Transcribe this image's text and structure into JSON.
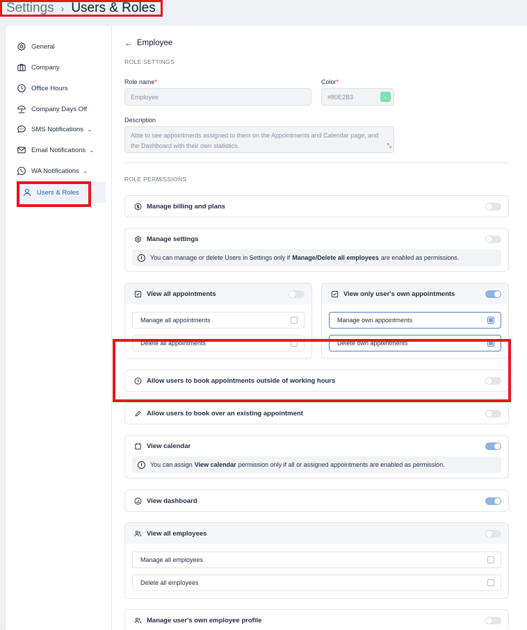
{
  "breadcrumb": {
    "root": "Settings",
    "separator": "›",
    "current": "Users & Roles"
  },
  "sidebar": {
    "items": [
      {
        "label": "General",
        "icon": "gear-icon"
      },
      {
        "label": "Company",
        "icon": "briefcase-icon"
      },
      {
        "label": "Office Hours",
        "icon": "clock-icon"
      },
      {
        "label": "Company Days Off",
        "icon": "umbrella-icon"
      },
      {
        "label": "SMS Notifications",
        "icon": "chat-bubble-icon",
        "chevron": "⌄"
      },
      {
        "label": "Email Notifications",
        "icon": "envelope-icon",
        "chevron": "⌄"
      },
      {
        "label": "WA Notifications",
        "icon": "whatsapp-icon",
        "chevron": "⌄"
      },
      {
        "label": "Users & Roles",
        "icon": "user-icon",
        "active": true
      }
    ]
  },
  "header": {
    "back_arrow": "←",
    "title": "Employee"
  },
  "role_settings": {
    "heading": "ROLE SETTINGS",
    "role_name_label": "Role name",
    "role_name_value": "Employee",
    "color_label": "Color",
    "color_value": "#80E2B3",
    "description_label": "Description",
    "description_value": "Able to see appointments assigned to them on the Appointments and Calendar page, and the Dashboard with their own statistics.",
    "required_mark": "*"
  },
  "permissions": {
    "heading": "ROLE PERMISSIONS",
    "billing": {
      "label": "Manage billing and plans",
      "enabled": false
    },
    "settings": {
      "label": "Manage settings",
      "enabled": false,
      "info_pre": "You can manage or delete Users in Settings only if",
      "info_bold": "Manage/Delete all employees",
      "info_post": "are enabled as permissions."
    },
    "view_all_appointments": {
      "label": "View all appointments",
      "enabled": false,
      "manage": "Manage all appointments",
      "delete": "Delete all appointments"
    },
    "view_own_appointments": {
      "label": "View only user's own appointments",
      "enabled": true,
      "manage": "Manage own appointments",
      "delete": "Delete own appointments"
    },
    "outside_hours": {
      "label": "Allow users to book appointments outside of working hours",
      "enabled": false
    },
    "overbook": {
      "label": "Allow users to book over an existing appointment",
      "enabled": false
    },
    "calendar": {
      "label": "View calendar",
      "enabled": true,
      "info_pre": "You can assign",
      "info_bold": "View calendar",
      "info_post": "permission only if all or assigned appointments are enabled as permission."
    },
    "dashboard": {
      "label": "View dashboard",
      "enabled": true
    },
    "employees": {
      "label": "View all employees",
      "enabled": false,
      "manage": "Manage all employees",
      "delete": "Delete all employees"
    },
    "own_profile": {
      "label": "Manage user's own employee profile",
      "enabled": false
    }
  },
  "info_icon": "i",
  "colors": {
    "accent": "#1c5fa8",
    "toggle_on": "#8fb3e3",
    "highlight": "#e8161b",
    "swatch": "#80E2B3"
  }
}
